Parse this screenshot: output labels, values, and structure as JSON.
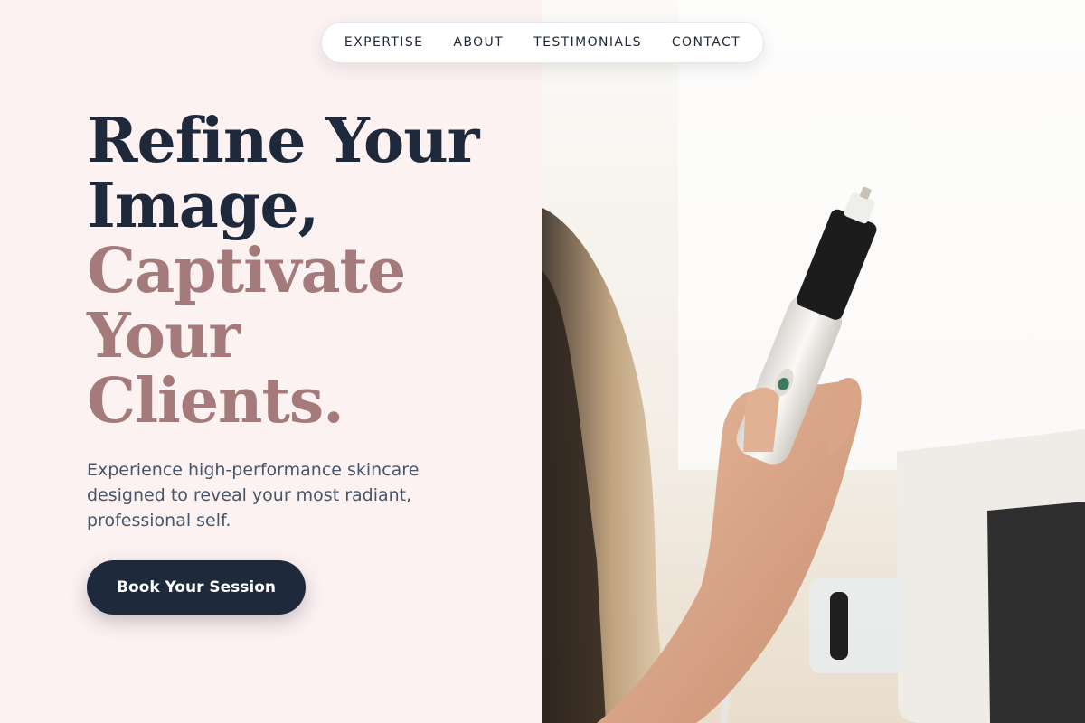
{
  "nav": {
    "items": [
      {
        "label": "EXPERTISE"
      },
      {
        "label": "ABOUT"
      },
      {
        "label": "TESTIMONIALS"
      },
      {
        "label": "CONTACT"
      }
    ]
  },
  "hero": {
    "headline_line1": "Refine Your",
    "headline_line2": "Image,",
    "headline_line3": "Captivate",
    "headline_line4": "Your",
    "headline_line5": "Clients.",
    "description": "Experience high-performance skincare designed to reveal your most radiant, professional self.",
    "cta_label": "Book Your Session"
  },
  "photo": {
    "subject": "hand holding skincare device"
  },
  "colors": {
    "background": "#fdf2f2",
    "primary": "#1e293b",
    "accent": "#a47a7a",
    "body_text": "#475569"
  }
}
